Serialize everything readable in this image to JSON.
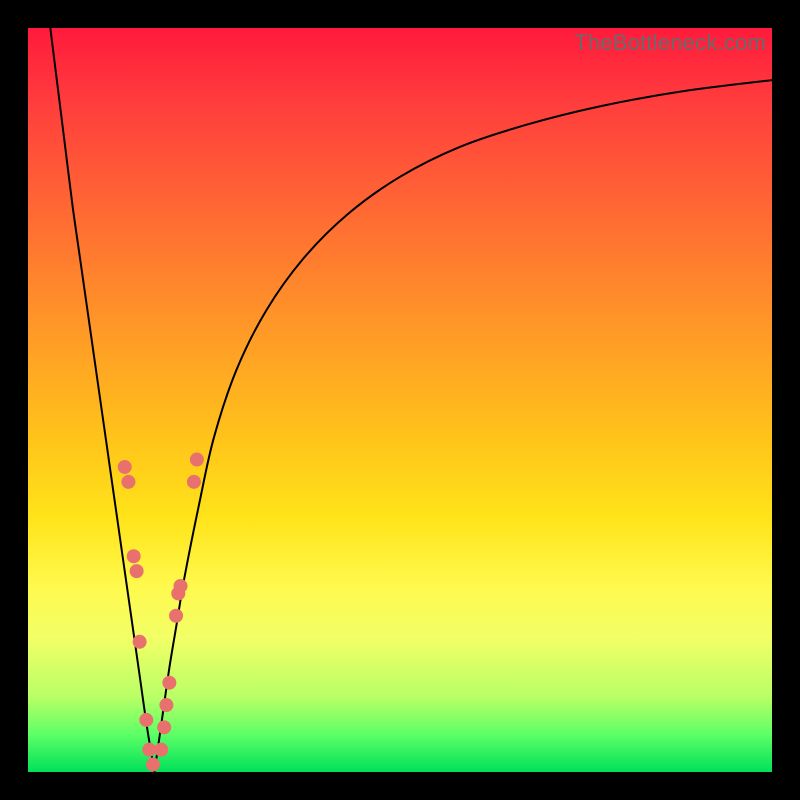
{
  "watermark": "TheBottleneck.com",
  "chart_data": {
    "type": "line",
    "title": "",
    "xlabel": "",
    "ylabel": "",
    "xlim": [
      0,
      100
    ],
    "ylim": [
      0,
      100
    ],
    "grid": false,
    "series": [
      {
        "name": "left-branch",
        "x": [
          3,
          4,
          5,
          6,
          7,
          8,
          9,
          10,
          11,
          12,
          13,
          14,
          15,
          16,
          17
        ],
        "y": [
          100,
          92,
          84,
          76,
          69,
          62,
          55,
          48,
          41,
          34,
          27,
          20,
          13,
          6,
          0
        ]
      },
      {
        "name": "right-branch",
        "x": [
          17,
          18,
          19,
          20,
          21,
          23,
          25,
          28,
          32,
          37,
          43,
          50,
          58,
          67,
          77,
          88,
          100
        ],
        "y": [
          0,
          7,
          14,
          20,
          26,
          36,
          45,
          54,
          62,
          69,
          75,
          80,
          84,
          87,
          89.5,
          91.5,
          93
        ]
      }
    ],
    "points": [
      {
        "name": "dot-left-1",
        "x": 13.0,
        "y": 41
      },
      {
        "name": "dot-left-2",
        "x": 13.5,
        "y": 39
      },
      {
        "name": "dot-left-3",
        "x": 14.2,
        "y": 29
      },
      {
        "name": "dot-left-4",
        "x": 14.6,
        "y": 27
      },
      {
        "name": "dot-left-5",
        "x": 15.0,
        "y": 17.5
      },
      {
        "name": "dot-left-6",
        "x": 15.9,
        "y": 7
      },
      {
        "name": "dot-left-7",
        "x": 16.3,
        "y": 3
      },
      {
        "name": "dot-left-8",
        "x": 16.8,
        "y": 1
      },
      {
        "name": "dot-right-1",
        "x": 17.9,
        "y": 3
      },
      {
        "name": "dot-right-2",
        "x": 18.3,
        "y": 6
      },
      {
        "name": "dot-right-3",
        "x": 18.6,
        "y": 9
      },
      {
        "name": "dot-right-4",
        "x": 19.0,
        "y": 12
      },
      {
        "name": "dot-right-5",
        "x": 19.9,
        "y": 21
      },
      {
        "name": "dot-right-6",
        "x": 20.2,
        "y": 24
      },
      {
        "name": "dot-right-7",
        "x": 20.5,
        "y": 25
      },
      {
        "name": "dot-right-8",
        "x": 22.3,
        "y": 39
      },
      {
        "name": "dot-right-9",
        "x": 22.7,
        "y": 42
      }
    ]
  }
}
